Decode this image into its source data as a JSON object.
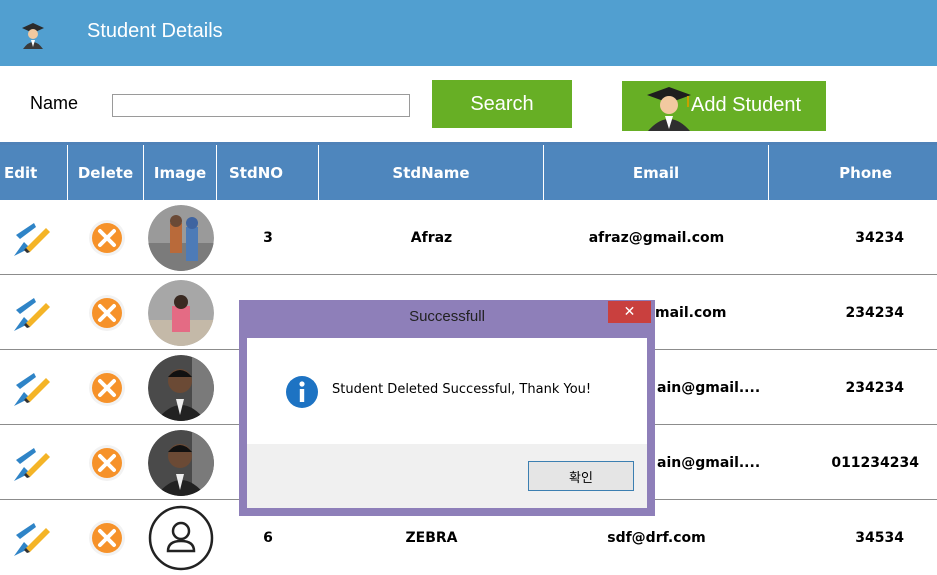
{
  "window": {
    "title": "Student Details"
  },
  "toolbar": {
    "name_label": "Name",
    "name_value": "",
    "search_label": "Search",
    "add_label": "Add Student"
  },
  "table": {
    "headers": {
      "edit": "Edit",
      "delete": "Delete",
      "image": "Image",
      "stdno": "StdNO",
      "stdname": "StdName",
      "email": "Email",
      "phone": "Phone"
    },
    "rows": [
      {
        "stdno": "3",
        "stdname": "Afraz",
        "email": "afraz@gmail.com",
        "phone": "34234"
      },
      {
        "stdno": "",
        "stdname": "",
        "email": "mail.com",
        "phone": "234234"
      },
      {
        "stdno": "",
        "stdname": "",
        "email": "ain@gmail....",
        "phone": "234234"
      },
      {
        "stdno": "",
        "stdname": "",
        "email": "ain@gmail....",
        "phone": "011234234"
      },
      {
        "stdno": "6",
        "stdname": "ZEBRA",
        "email": "sdf@drf.com",
        "phone": "34534"
      }
    ]
  },
  "dialog": {
    "title": "Successfull",
    "close": "✕",
    "message": "Student Deleted Successful, Thank You!",
    "ok_label": "확인"
  },
  "colors": {
    "titlebar": "#519fd0",
    "header": "#4e86bd",
    "button": "#67af25",
    "dialog_frame": "#8e7fb9",
    "close": "#c9403e"
  }
}
